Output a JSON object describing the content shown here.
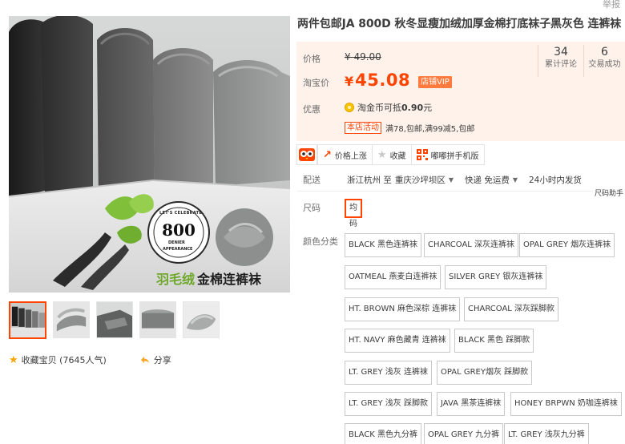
{
  "header": {
    "report_label": "举报"
  },
  "product": {
    "title": "两件包邮JA 800D 秋冬显瘦加绒加厚金棉打底袜子黑灰色 连裤袜"
  },
  "gallery": {
    "main_image_badge_top": "LET'S CELEBRATE",
    "main_image_badge_number": "800",
    "main_image_badge_mid": "DENIER",
    "main_image_badge_bottom": "APPEARANCE",
    "main_image_caption_green": "羽毛绒",
    "main_image_caption_black": "金棉连裤袜",
    "thumb_count": 5
  },
  "actions_left": {
    "favorite_label": "收藏宝贝 (7645人气)",
    "share_label": "分享"
  },
  "price": {
    "price_label": "价格",
    "original_price": "¥ 49.00",
    "taobao_price_label": "淘宝价",
    "yen": "¥",
    "current_price": "45.08",
    "vip_badge": "店铺VIP",
    "stats": [
      {
        "value": "34",
        "label": "累计评论"
      },
      {
        "value": "6",
        "label": "交易成功"
      }
    ],
    "discount_label": "优惠",
    "coin_text_prefix": "淘金币可抵",
    "coin_amount": "0.90",
    "coin_text_suffix": "元",
    "promo_tag": "本店活动",
    "promo_text": "满78,包邮,满99减5,包邮"
  },
  "toolbar": {
    "price_alert": "价格上涨",
    "collect": "收藏",
    "mobile": "嘟嘟拼手机版"
  },
  "delivery": {
    "label": "配送",
    "from": "浙江杭州 至",
    "to": "重庆沙坪坝区",
    "shipping": "快递 免运费",
    "dispatch": "24小时内发货",
    "size_helper": "尺码助手"
  },
  "size": {
    "label": "尺码",
    "selected": "均码"
  },
  "colors": {
    "label": "颜色分类",
    "options": [
      "BLACK 黑色连裤袜",
      "CHARCOAL 深灰连裤袜",
      "OPAL GREY 烟灰连裤袜",
      "OATMEAL 燕麦白连裤袜",
      "SILVER GREY 银灰连裤袜",
      "HT. BROWN 麻色深棕 连裤袜",
      "CHARCOAL 深灰踩脚款",
      "HT. NAVY 麻色藏青 连裤袜",
      "BLACK 黑色 踩脚款",
      "LT. GREY 浅灰 连裤袜",
      "OPAL GREY烟灰 踩脚款",
      "LT. GREY 浅灰 踩脚款",
      "JAVA 黑茶连裤袜",
      "HONEY BRPWN 奶咖连裤袜",
      "BLACK 黑色九分裤",
      "OPAL GREY 九分裤",
      "LT. GREY 浅灰九分裤"
    ]
  },
  "theme": {
    "accent": "#ff4400",
    "price_panel_bg": "#fef2eb",
    "border": "#c9c9c9"
  }
}
